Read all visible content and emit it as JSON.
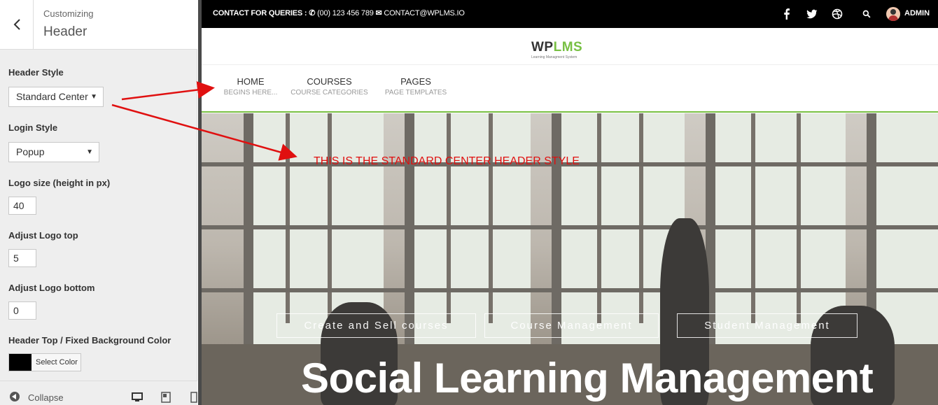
{
  "customizer": {
    "breadcrumb": "Customizing",
    "section_title": "Header",
    "controls": {
      "header_style_label": "Header Style",
      "header_style_value": "Standard Center",
      "login_style_label": "Login Style",
      "login_style_value": "Popup",
      "logo_size_label": "Logo size (height in px)",
      "logo_size_value": "40",
      "logo_top_label": "Adjust Logo top",
      "logo_top_value": "5",
      "logo_bottom_label": "Adjust Logo bottom",
      "logo_bottom_value": "0",
      "bg_color_label": "Header Top / Fixed Background Color",
      "bg_color_button": "Select Color",
      "bg_color_value": "#000000"
    },
    "footer": {
      "collapse_label": "Collapse"
    }
  },
  "preview": {
    "topbar": {
      "contact_label": "CONTACT FOR QUERIES :",
      "phone": "(00) 123 456 789",
      "email": "CONTACT@WPLMS.IO",
      "user": "ADMIN"
    },
    "logo": {
      "part1": "WP",
      "part2": "LMS",
      "tagline": "Learning Managment System"
    },
    "nav": [
      {
        "title": "HOME",
        "sub": "BEGINS HERE..."
      },
      {
        "title": "COURSES",
        "sub": "COURSE CATEGORIES"
      },
      {
        "title": "PAGES",
        "sub": "PAGE TEMPLATES"
      }
    ],
    "annotation": "THIS IS THE STANDARD CENTER HEADER STYLE",
    "hero_buttons": [
      "Create and Sell courses",
      "Course Management",
      "Student Management"
    ],
    "hero_title": "Social Learning Management"
  },
  "colors": {
    "accent": "#78c043",
    "annotation": "#e01010",
    "topbar": "#000000"
  },
  "icons": [
    "back-chevron-icon",
    "caret-down-icon",
    "collapse-icon",
    "desktop-icon",
    "tablet-icon",
    "mobile-icon",
    "phone-icon",
    "envelope-icon",
    "facebook-icon",
    "twitter-icon",
    "dribbble-icon",
    "search-icon"
  ]
}
